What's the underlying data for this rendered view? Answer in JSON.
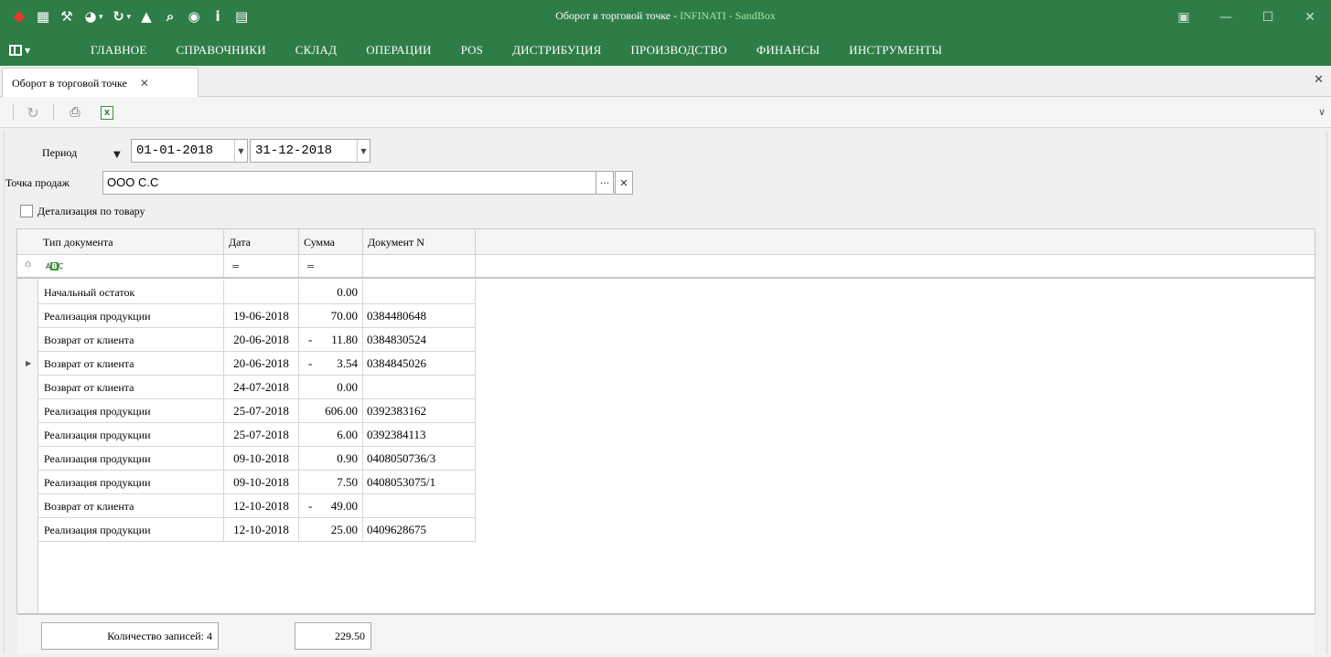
{
  "window": {
    "title": "Оборот в торговой точке",
    "title_sep": " - ",
    "app_name": "INFINATI - SandBox"
  },
  "quick_access": [
    "app-icon",
    "calendar-icon",
    "tools-icon",
    "palette-icon",
    "refresh-icon",
    "user-icon",
    "search-icon",
    "location-icon",
    "info-icon",
    "chat-icon"
  ],
  "menu": {
    "items": [
      "ГЛАВНОЕ",
      "СПРАВОЧНИКИ",
      "СКЛАД",
      "ОПЕРАЦИИ",
      "POS",
      "ДИСТРИБУЦИЯ",
      "ПРОИЗВОДСТВО",
      "ФИНАНСЫ",
      "ИНСТРУМЕНТЫ"
    ]
  },
  "tab": {
    "label": "Оборот в торговой точке",
    "close": "✕"
  },
  "filters": {
    "period_label": "Период",
    "date_from": "01-01-2018",
    "date_to": "31-12-2018",
    "point_label": "Точка продаж",
    "point_value": "ООО С.С",
    "browse_btn": "···",
    "clear_btn": "✕",
    "detail_label": "Детализация по товару",
    "detail_checked": false
  },
  "grid": {
    "columns": [
      "Тип документа",
      "Дата",
      "Сумма",
      "Документ N"
    ],
    "filter_eq": "=",
    "rows": [
      {
        "type": "Начальный остаток",
        "date": "",
        "sign": "",
        "sum": "0.00",
        "doc": ""
      },
      {
        "type": "Реализация продукции",
        "date": "19-06-2018",
        "sign": "",
        "sum": "70.00",
        "doc": "0384480648"
      },
      {
        "type": "Возврат от клиента",
        "date": "20-06-2018",
        "sign": "-",
        "sum": "11.80",
        "doc": "0384830524"
      },
      {
        "type": "Возврат от клиента",
        "date": "20-06-2018",
        "sign": "-",
        "sum": "3.54",
        "doc": "0384845026"
      },
      {
        "type": "Возврат от клиента",
        "date": "24-07-2018",
        "sign": "",
        "sum": "0.00",
        "doc": ""
      },
      {
        "type": "Реализация продукции",
        "date": "25-07-2018",
        "sign": "",
        "sum": "606.00",
        "doc": "0392383162"
      },
      {
        "type": "Реализация продукции",
        "date": "25-07-2018",
        "sign": "",
        "sum": "6.00",
        "doc": "0392384113"
      },
      {
        "type": "Реализация продукции",
        "date": "09-10-2018",
        "sign": "",
        "sum": "0.90",
        "doc": "0408050736/3"
      },
      {
        "type": "Реализация продукции",
        "date": "09-10-2018",
        "sign": "",
        "sum": "7.50",
        "doc": "0408053075/1"
      },
      {
        "type": "Возврат от клиента",
        "date": "12-10-2018",
        "sign": "-",
        "sum": "49.00",
        "doc": ""
      },
      {
        "type": "Реализация продукции",
        "date": "12-10-2018",
        "sign": "",
        "sum": "25.00",
        "doc": "0409628675"
      }
    ],
    "current_row": 3
  },
  "footer": {
    "count_label": "Количество записей: 4",
    "total": "229.50"
  }
}
